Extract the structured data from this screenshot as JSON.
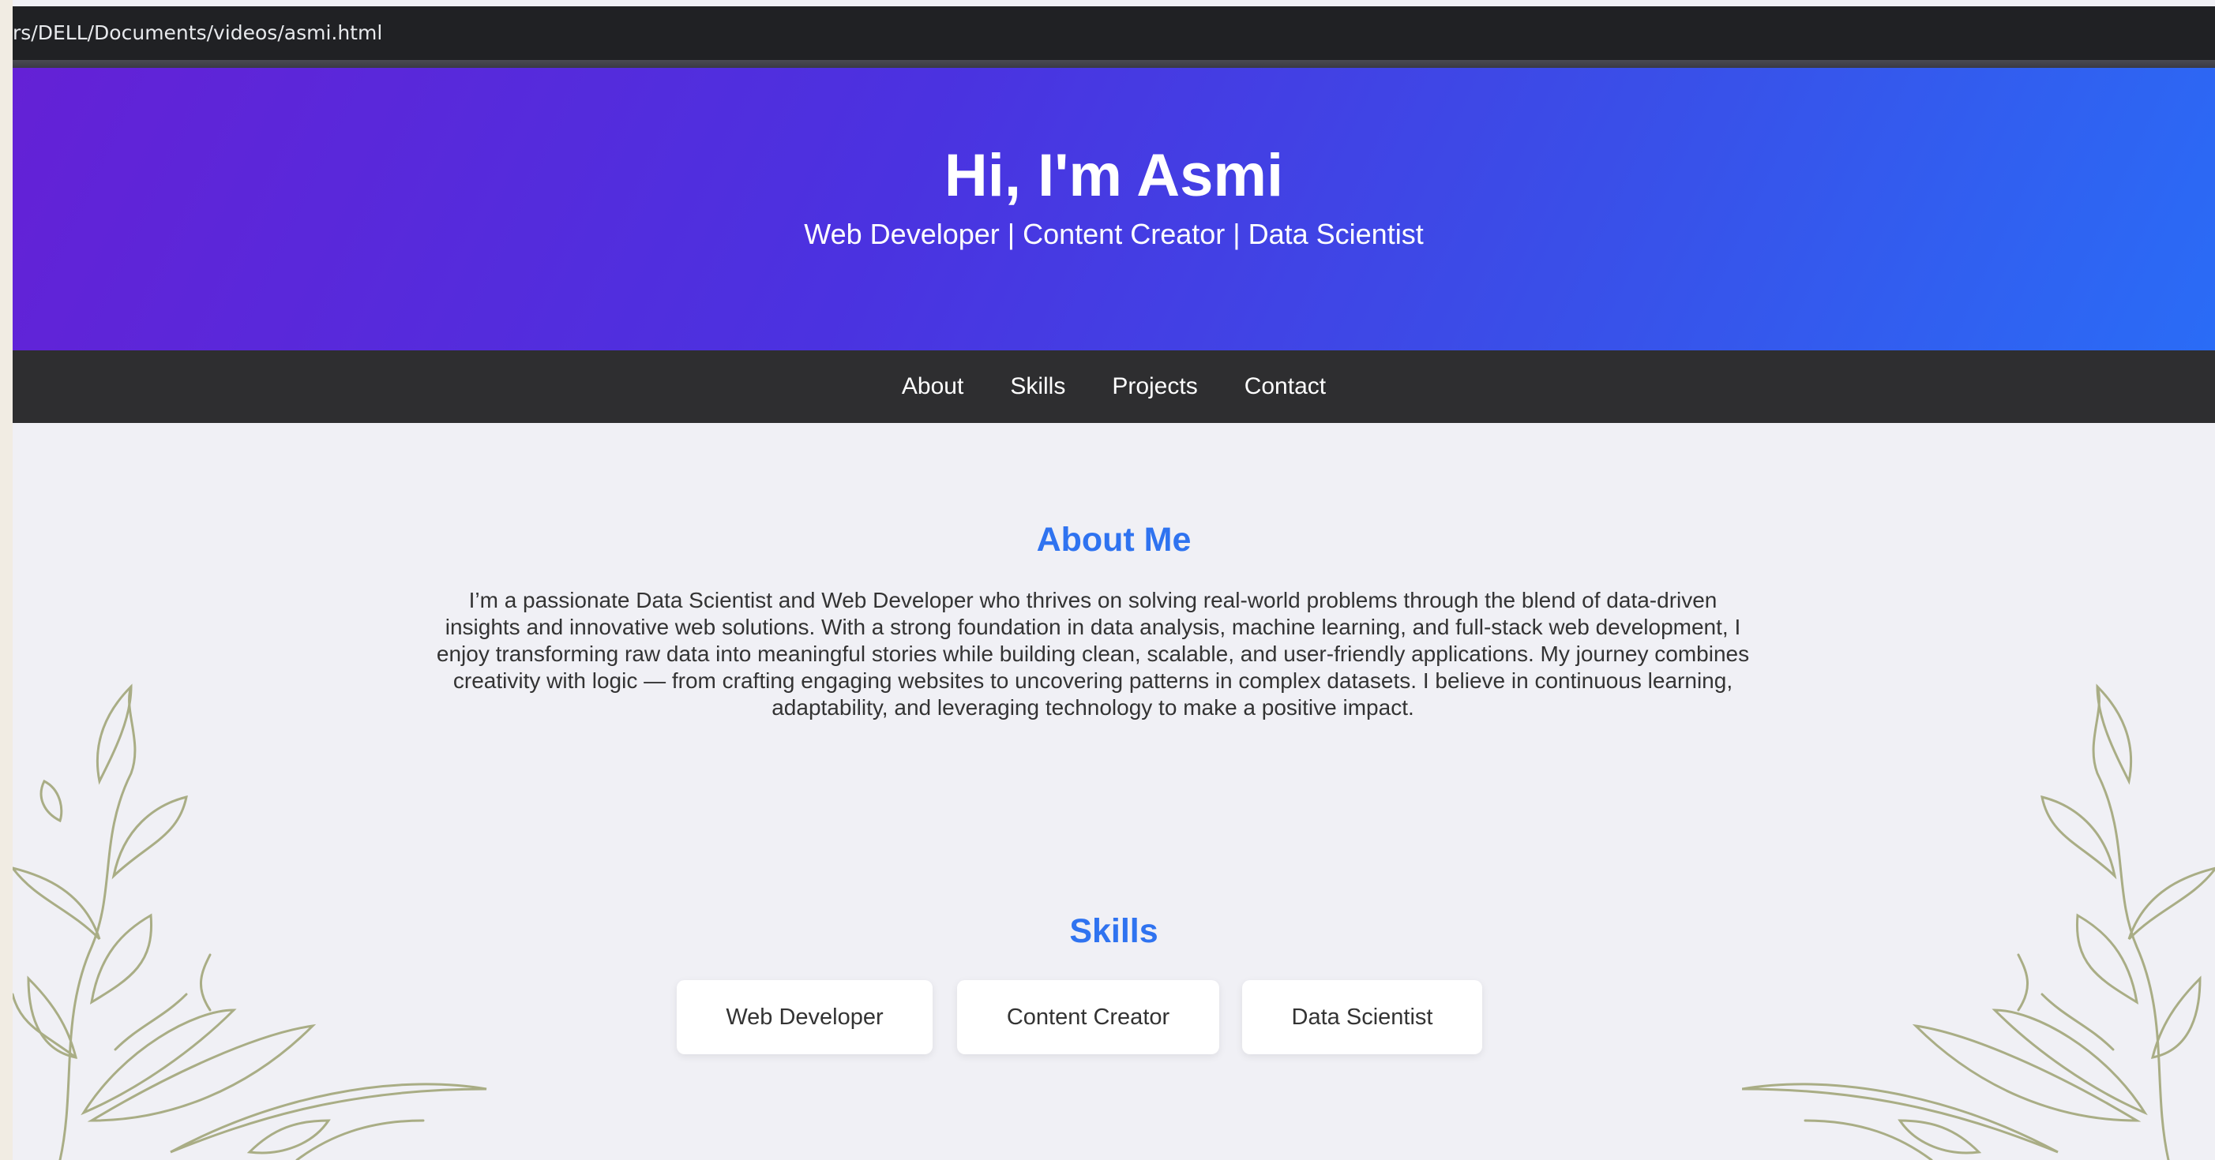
{
  "browser": {
    "url": "rs/DELL/Documents/videos/asmi.html"
  },
  "hero": {
    "title": "Hi, I'm Asmi",
    "subtitle": "Web Developer | Content Creator | Data Scientist"
  },
  "nav": {
    "items": [
      "About",
      "Skills",
      "Projects",
      "Contact"
    ]
  },
  "about": {
    "title": "About Me",
    "text": "I’m a passionate Data Scientist and Web Developer who thrives on solving real-world problems through the blend of data-driven insights and innovative web solutions. With a strong foundation in data analysis, machine learning, and full-stack web development, I enjoy transforming raw data into meaningful stories while building clean, scalable, and user-friendly applications. My journey combines creativity with logic — from crafting engaging websites to uncovering patterns in complex datasets. I believe in continuous learning, adaptability, and leveraging technology to make a positive impact."
  },
  "skills": {
    "title": "Skills",
    "items": [
      "Web Developer",
      "Content Creator",
      "Data Scientist"
    ]
  },
  "colors": {
    "accent": "#2f73f0",
    "hero_start": "#6421d6",
    "hero_end": "#2a6cf6",
    "nav_bg": "#2e2e30",
    "page_bg": "#f0f0f5",
    "leaf": "#a9ad85"
  }
}
